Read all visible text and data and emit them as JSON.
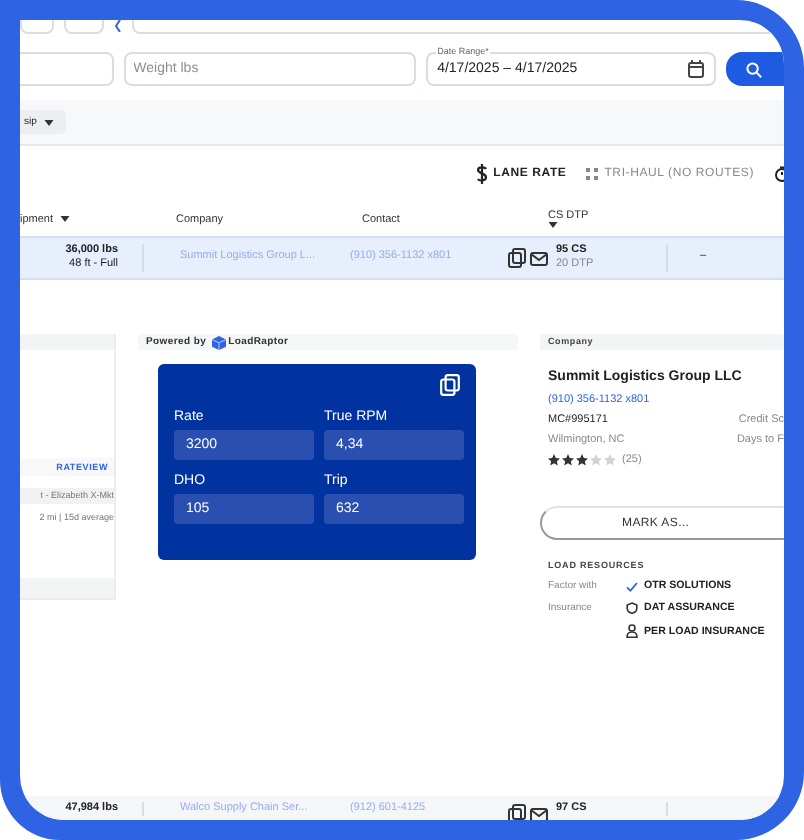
{
  "filters": {
    "weight": {
      "placeholder": "Weight lbs"
    },
    "date_range": {
      "label": "Date Range*",
      "value": "4/17/2025 – 4/17/2025"
    }
  },
  "chip": {
    "label": "sip"
  },
  "toolbar": {
    "actions": [
      {
        "kind": "dollar",
        "label": "LANE RATE",
        "disabled": false
      },
      {
        "kind": "grid",
        "label": "TRI-HAUL (NO ROUTES)",
        "disabled": true
      },
      {
        "kind": "clock",
        "disabled": false
      }
    ]
  },
  "table": {
    "columns": [
      {
        "label": "ipment",
        "sort_caret": true
      },
      {
        "label": "Company",
        "sort_caret": false
      },
      {
        "label": "Contact",
        "sort_caret": false
      },
      {
        "label": "CS DTP",
        "sort_caret": true
      }
    ],
    "rows": [
      {
        "selected": true,
        "weight": "36,000 lbs",
        "equipment": "48 ft - Full",
        "company": "Summit Logistics Group L...",
        "contact": "(910) 356-1132 x801",
        "cs": "95 CS",
        "dtp": "20 DTP",
        "column_5": "–"
      },
      {
        "selected": false,
        "weight": "47,984 lbs",
        "company": "Walco Supply Chain Ser...",
        "contact": "(912) 601-4125",
        "cs": "97 CS"
      }
    ]
  },
  "rate_panel": {
    "link": "RATEVIEW",
    "lane": "t - Elizabeth X-Mkt",
    "stats": "2 mi | 15d average"
  },
  "rate_card": {
    "powered_by": "Powered by",
    "brand": "LoadRaptor",
    "fields": [
      {
        "label": "Rate",
        "value": "3200"
      },
      {
        "label": "True RPM",
        "value": "4,34"
      },
      {
        "label": "DHO",
        "value": "105"
      },
      {
        "label": "Trip",
        "value": "632"
      }
    ]
  },
  "company_panel": {
    "heading": "Company",
    "name": "Summit Logistics Group LLC",
    "phone": "(910) 356-1132 x801",
    "mc": "MC#995171",
    "location": "Wilmington, NC",
    "credit_label": "Credit Sc",
    "days_label": "Days to F",
    "stars": 3,
    "reviews": "(25)",
    "mark_button": "MARK AS...",
    "resources": {
      "heading": "LOAD RESOURCES",
      "items": [
        {
          "kind": "check",
          "label": "Factor with",
          "value": "OTR SOLUTIONS"
        },
        {
          "kind": "shield",
          "label": "Insurance",
          "value": "DAT ASSURANCE"
        },
        {
          "kind": "person",
          "value": "PER LOAD INSURANCE"
        }
      ]
    }
  }
}
